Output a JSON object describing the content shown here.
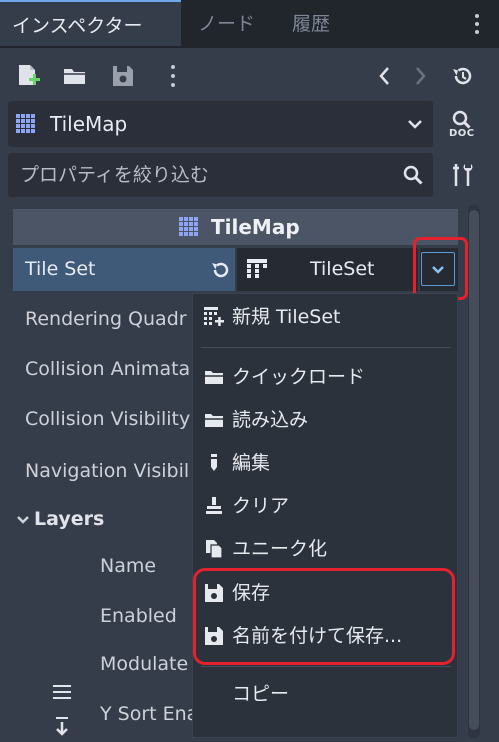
{
  "tabs": [
    {
      "label": "インスペクター",
      "active": true
    },
    {
      "label": "ノード",
      "active": false
    },
    {
      "label": "履歴",
      "active": false
    }
  ],
  "toolbar": {
    "icons": [
      "new-resource-icon",
      "open-folder-icon",
      "save-icon",
      "more-options-icon",
      "history-back-icon",
      "history-forward-icon",
      "object-history-icon"
    ]
  },
  "resource": {
    "name": "TileMap",
    "doc_label": "DOC"
  },
  "filter": {
    "placeholder": "プロパティを絞り込む"
  },
  "section": {
    "title": "TileMap"
  },
  "tileset_prop": {
    "label": "Tile Set",
    "value": "TileSet"
  },
  "props": {
    "rendering_quadrant": "Rendering Quadr",
    "collision_animatable": "Collision Animata",
    "collision_visibility": "Collision Visibility",
    "navigation_visibility": "Navigation Visibil",
    "layers": "Layers",
    "name": "Name",
    "enabled": "Enabled",
    "modulate": "Modulate",
    "y_sort": "Y Sort Enab"
  },
  "menu": {
    "items": [
      {
        "label": "新規 TileSet",
        "icon": "new-tileset-icon"
      },
      {
        "label": "クイックロード",
        "icon": "folder-icon"
      },
      {
        "label": "読み込み",
        "icon": "folder-icon"
      },
      {
        "label": "編集",
        "icon": "edit-icon"
      },
      {
        "label": "クリア",
        "icon": "clear-icon"
      },
      {
        "label": "ユニーク化",
        "icon": "make-unique-icon"
      },
      {
        "label": "保存",
        "icon": "save-icon"
      },
      {
        "label": "名前を付けて保存...",
        "icon": "save-icon"
      },
      {
        "label": "コピー",
        "icon": ""
      }
    ]
  },
  "colors": {
    "background": "#363d4a",
    "accent": "#6fa8ea",
    "highlight": "#e4222e",
    "selected_row": "#3e5a78"
  }
}
